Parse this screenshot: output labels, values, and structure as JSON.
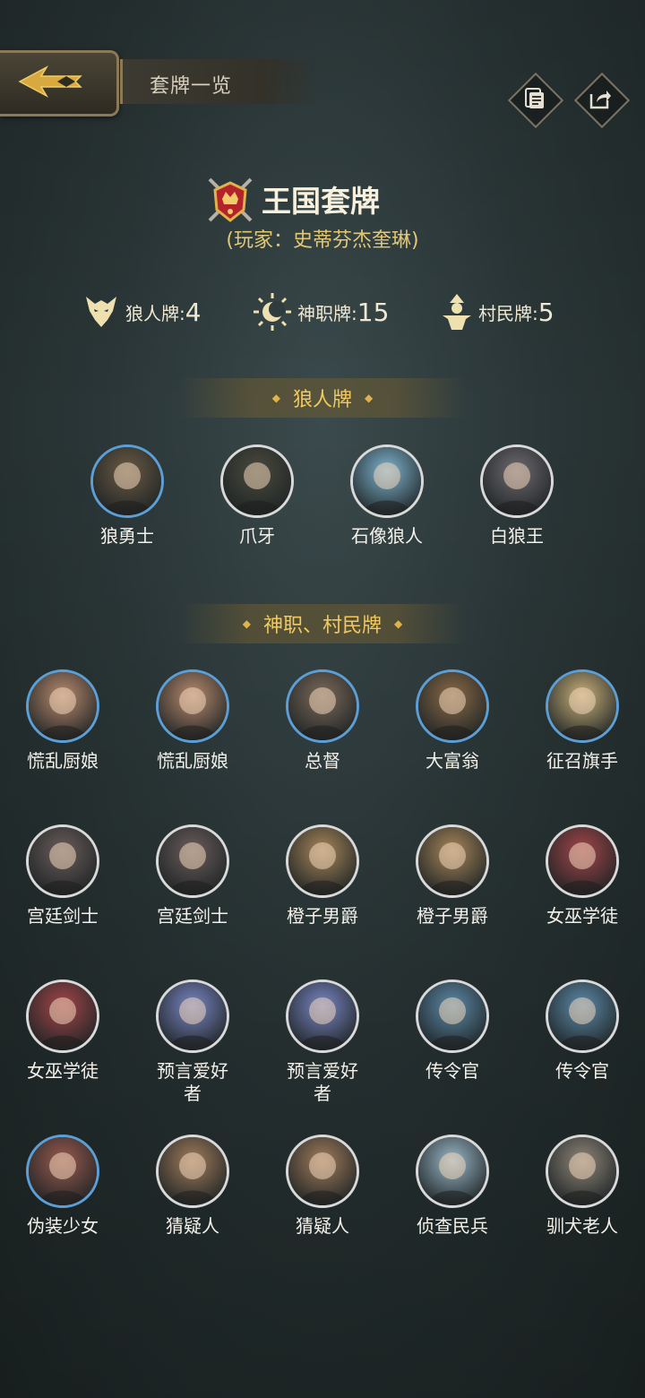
{
  "header": {
    "title": "套牌一览"
  },
  "deck": {
    "name": "王国套牌",
    "player": "(玩家：史蒂芬杰奎琳)"
  },
  "stats": [
    {
      "label": "狼人牌:",
      "value": "4",
      "icon": "wolf-icon"
    },
    {
      "label": "神职牌:",
      "value": "15",
      "icon": "sun-moon-icon"
    },
    {
      "label": "村民牌:",
      "value": "5",
      "icon": "villager-icon"
    }
  ],
  "sections": {
    "wolves": "狼人牌",
    "gods_villagers": "神职、村民牌"
  },
  "wolves": [
    {
      "name": "狼勇士",
      "ring": "blue",
      "color": "#6b5a45"
    },
    {
      "name": "爪牙",
      "ring": "gray",
      "color": "#4b4a3e"
    },
    {
      "name": "石像狼人",
      "ring": "gray",
      "color": "#7fb4cf"
    },
    {
      "name": "白狼王",
      "ring": "gray",
      "color": "#6f6a70"
    }
  ],
  "cards": [
    {
      "name": "慌乱厨娘",
      "ring": "blue",
      "color": "#b98a6e"
    },
    {
      "name": "慌乱厨娘",
      "ring": "blue",
      "color": "#b98a6e"
    },
    {
      "name": "总督",
      "ring": "blue",
      "color": "#7d6a5a"
    },
    {
      "name": "大富翁",
      "ring": "blue",
      "color": "#8a6a47"
    },
    {
      "name": "征召旗手",
      "ring": "blue",
      "color": "#c9b07a"
    },
    {
      "name": "宫廷剑士",
      "ring": "gray",
      "color": "#6b5d5c"
    },
    {
      "name": "宫廷剑士",
      "ring": "gray",
      "color": "#6b5d5c"
    },
    {
      "name": "橙子男爵",
      "ring": "gray",
      "color": "#a8865a"
    },
    {
      "name": "橙子男爵",
      "ring": "gray",
      "color": "#a8865a"
    },
    {
      "name": "女巫学徒",
      "ring": "gray",
      "color": "#a3464a"
    },
    {
      "name": "女巫学徒",
      "ring": "gray",
      "color": "#a3464a"
    },
    {
      "name": "预言爱好者",
      "ring": "gray",
      "color": "#7a86c4"
    },
    {
      "name": "预言爱好者",
      "ring": "gray",
      "color": "#7a86c4"
    },
    {
      "name": "传令官",
      "ring": "gray",
      "color": "#5d8aa9"
    },
    {
      "name": "传令官",
      "ring": "gray",
      "color": "#5d8aa9"
    },
    {
      "name": "伪装少女",
      "ring": "blue",
      "color": "#9a5a4f"
    },
    {
      "name": "猜疑人",
      "ring": "gray",
      "color": "#a17c5c"
    },
    {
      "name": "猜疑人",
      "ring": "gray",
      "color": "#a17c5c"
    },
    {
      "name": "侦查民兵",
      "ring": "gray",
      "color": "#9ab7c8"
    },
    {
      "name": "驯犬老人",
      "ring": "gray",
      "color": "#8f8679"
    }
  ]
}
